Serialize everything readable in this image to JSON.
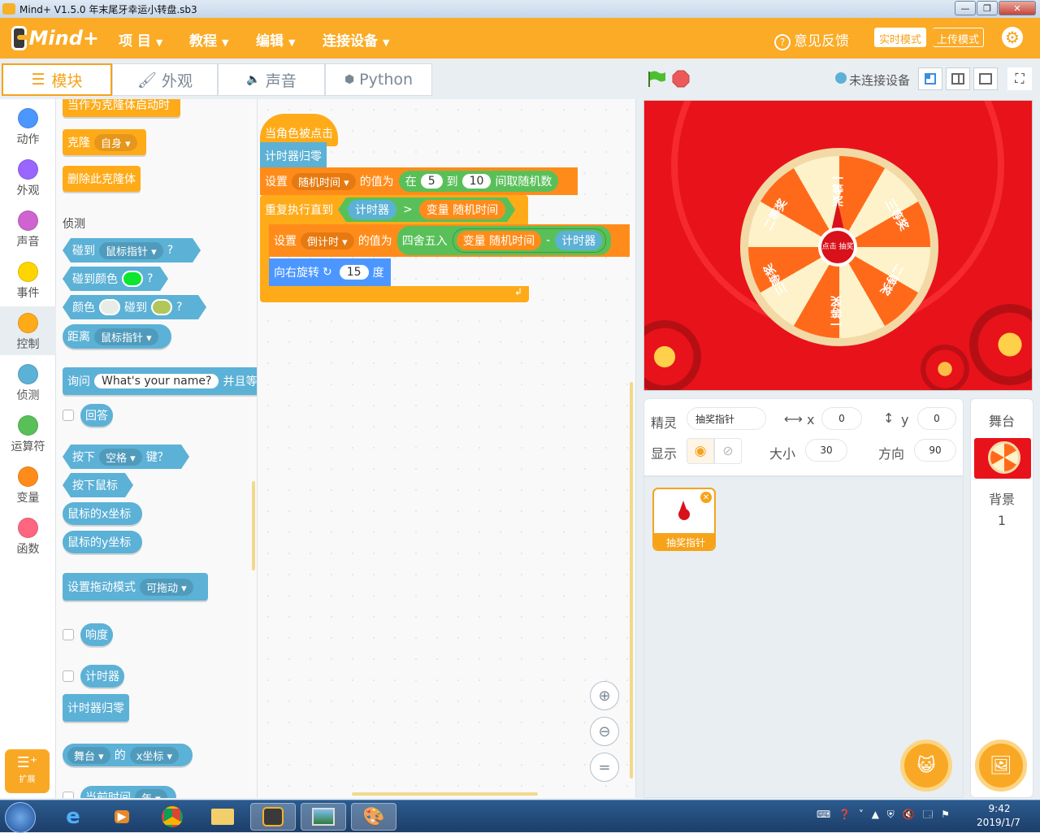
{
  "window": {
    "title": "Mind+ V1.5.0      年末尾牙幸运小转盘.sb3"
  },
  "menu": {
    "logo": "Mind+",
    "items": [
      "项 目",
      "教程",
      "编辑",
      "连接设备"
    ],
    "feedback": "意见反馈",
    "realtime_mode": "实时模式",
    "upload_mode": "上传模式"
  },
  "tabs": {
    "blocks": "模块",
    "looks": "外观",
    "sound": "声音",
    "python": "Python"
  },
  "device": {
    "status": "未连接设备"
  },
  "categories": [
    "动作",
    "外观",
    "声音",
    "事件",
    "控制",
    "侦测",
    "运算符",
    "变量",
    "函数"
  ],
  "extension": {
    "label": "扩展"
  },
  "palette": {
    "clone_start": "当作为克隆体启动时",
    "clone": "克隆",
    "clone_target": "自身",
    "delete_clone": "删除此克隆体",
    "section_sensing": "侦测",
    "touching": "碰到",
    "mouse_pointer": "鼠标指针",
    "touching_color": "碰到颜色",
    "color": "颜色",
    "touch": "碰到",
    "distance": "距离",
    "ask": "询问",
    "ask_default": "What's your name?",
    "and_wait": "并且等",
    "answer": "回答",
    "key_pressed": "按下",
    "key_space": "空格",
    "key": "键？",
    "mouse_down": "按下鼠标",
    "mouse_x": "鼠标的x坐标",
    "mouse_y": "鼠标的y坐标",
    "drag_mode": "设置拖动模式",
    "draggable": "可拖动",
    "loudness": "响度",
    "timer": "计时器",
    "reset_timer": "计时器归零",
    "stage": "舞台",
    "of": "的",
    "x_pos": "x坐标",
    "current_time": "当前时间",
    "year": "年"
  },
  "script": {
    "hat": "当角色被点击",
    "reset_timer": "计时器归零",
    "set": "设置",
    "var_random": "随机时间",
    "value_of": "的值为",
    "pick_random": "在",
    "from": "5",
    "to_word": "到",
    "to": "10",
    "pick_tail": "间取随机数",
    "repeat_until": "重复执行直到",
    "timer": "计时器",
    "gt": ">",
    "var_word": "变量",
    "var_random_ref": "随机时间",
    "set2": "设置",
    "var_countdown": "倒计时",
    "value_of2": "的值为",
    "round": "四舍五入",
    "var_word2": "变量",
    "var_random_ref2": "随机时间",
    "minus": "-",
    "timer2": "计时器",
    "turn_right": "向右旋转",
    "degrees": "15",
    "deg_word": "度"
  },
  "stage_view": {
    "hub": "点击\n抽奖",
    "prize_labels": [
      "一等奖",
      "三等奖",
      "二等奖",
      "三等奖",
      "一等奖",
      "二等奖"
    ]
  },
  "sprite_info": {
    "sprite_label": "精灵",
    "sprite_name": "抽奖指针",
    "x_label": "x",
    "x_value": "0",
    "y_label": "y",
    "y_value": "0",
    "show_label": "显示",
    "size_label": "大小",
    "size_value": "30",
    "direction_label": "方向",
    "direction_value": "90"
  },
  "sprites": [
    {
      "name": "抽奖指针"
    }
  ],
  "stage_panel": {
    "title": "舞台",
    "backdrop_label": "背景",
    "backdrop_count": "1"
  },
  "taskbar": {
    "time": "9:42",
    "date": "2019/1/7"
  },
  "colors": {
    "accent": "#fbab25",
    "control": "#ffab19",
    "sensing": "#5cb1d6",
    "operator": "#59c059",
    "variable": "#ff8c1a"
  }
}
